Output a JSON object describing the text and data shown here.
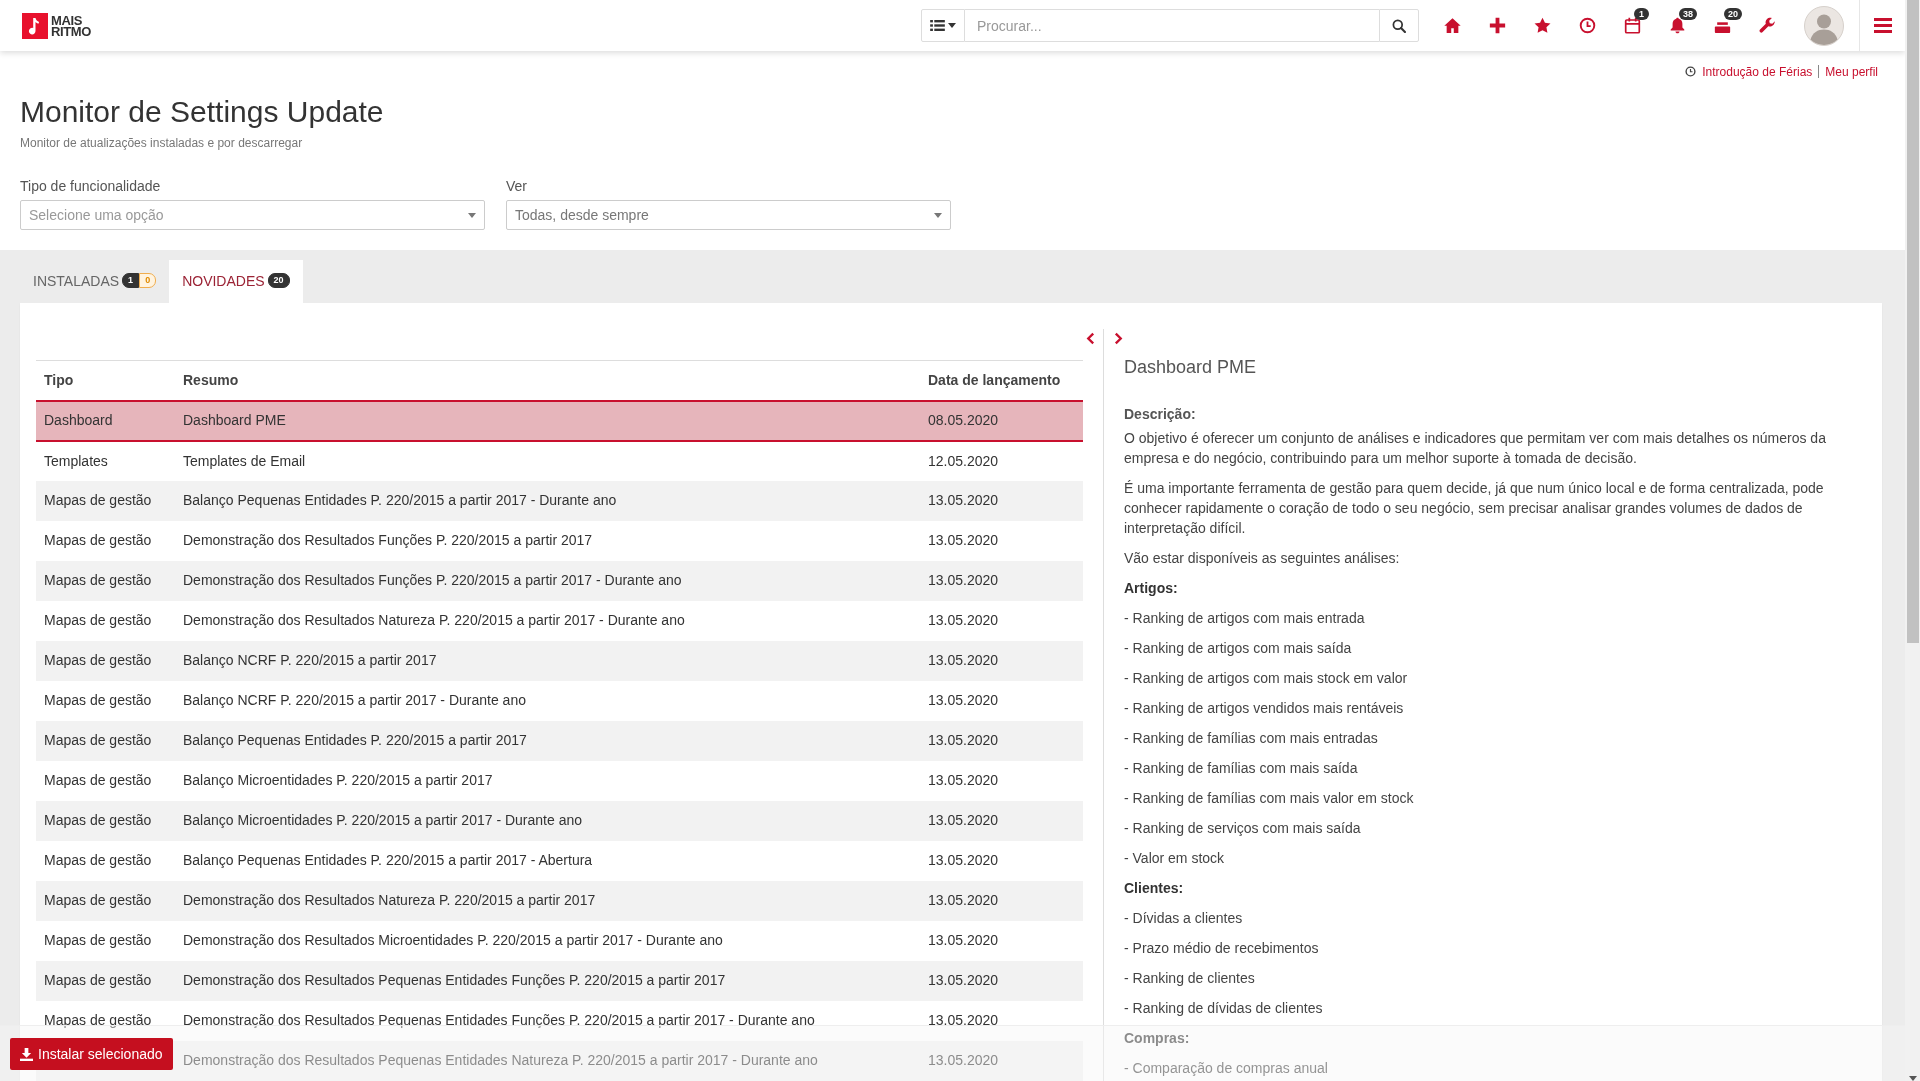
{
  "header": {
    "logo": {
      "line_1": "MAIS",
      "line_2": "RITMO"
    },
    "search": {
      "placeholder": "Procurar..."
    },
    "actions": [
      {
        "kind": "home"
      },
      {
        "kind": "plus"
      },
      {
        "kind": "star"
      },
      {
        "kind": "clock"
      },
      {
        "kind": "calendar",
        "count": "1"
      },
      {
        "kind": "bell",
        "count": "38"
      },
      {
        "kind": "tray",
        "count": "20"
      },
      {
        "kind": "wrench"
      }
    ]
  },
  "user_links": [
    "Introdução de Férias",
    "Meu perfil"
  ],
  "page": {
    "title": "Monitor de Settings Update",
    "subtitle": "Monitor de atualizações instaladas e por descarregar"
  },
  "filters": [
    {
      "label": "Tipo de funcionalidade",
      "placeholder": "Selecione uma opção"
    },
    {
      "label": "Ver",
      "value": "Todas, desde sempre"
    }
  ],
  "tabs": [
    {
      "label": "INSTALADAS",
      "selected": false,
      "badges": [
        {
          "text": "1",
          "kind": "dark"
        },
        {
          "text": "0",
          "kind": "warning"
        }
      ]
    },
    {
      "label": "NOVIDADES",
      "selected": true,
      "badges": [
        {
          "text": "20",
          "kind": "dark"
        }
      ]
    }
  ],
  "table": {
    "columns": [
      "Tipo",
      "Resumo",
      "Data de lançamento"
    ],
    "rows": [
      {
        "type": "Dashboard",
        "summary": "Dashboard PME",
        "date": "08.05.2020",
        "selected": true
      },
      {
        "type": "Templates",
        "summary": "Templates de Email",
        "date": "12.05.2020",
        "selected": false
      },
      {
        "type": "Mapas de gestão",
        "summary": "Balanço Pequenas Entidades P. 220/2015 a partir 2017 - Durante ano",
        "date": "13.05.2020",
        "selected": false
      },
      {
        "type": "Mapas de gestão",
        "summary": "Demonstração dos Resultados Funções P. 220/2015 a partir 2017",
        "date": "13.05.2020",
        "selected": false
      },
      {
        "type": "Mapas de gestão",
        "summary": "Demonstração dos Resultados Funções P. 220/2015 a partir 2017 - Durante ano",
        "date": "13.05.2020",
        "selected": false
      },
      {
        "type": "Mapas de gestão",
        "summary": "Demonstração dos Resultados Natureza P. 220/2015 a partir 2017 - Durante ano",
        "date": "13.05.2020",
        "selected": false
      },
      {
        "type": "Mapas de gestão",
        "summary": "Balanço NCRF P. 220/2015 a partir 2017",
        "date": "13.05.2020",
        "selected": false
      },
      {
        "type": "Mapas de gestão",
        "summary": "Balanço NCRF P. 220/2015 a partir 2017 - Durante ano",
        "date": "13.05.2020",
        "selected": false
      },
      {
        "type": "Mapas de gestão",
        "summary": "Balanço Pequenas Entidades P. 220/2015 a partir 2017",
        "date": "13.05.2020",
        "selected": false
      },
      {
        "type": "Mapas de gestão",
        "summary": "Balanço Microentidades P. 220/2015 a partir 2017",
        "date": "13.05.2020",
        "selected": false
      },
      {
        "type": "Mapas de gestão",
        "summary": "Balanço Microentidades P. 220/2015 a partir 2017 - Durante ano",
        "date": "13.05.2020",
        "selected": false
      },
      {
        "type": "Mapas de gestão",
        "summary": "Balanço Pequenas Entidades P. 220/2015 a partir 2017 - Abertura",
        "date": "13.05.2020",
        "selected": false
      },
      {
        "type": "Mapas de gestão",
        "summary": "Demonstração dos Resultados Natureza P. 220/2015 a partir 2017",
        "date": "13.05.2020",
        "selected": false
      },
      {
        "type": "Mapas de gestão",
        "summary": "Demonstração dos Resultados Microentidades P. 220/2015 a partir 2017 - Durante ano",
        "date": "13.05.2020",
        "selected": false
      },
      {
        "type": "Mapas de gestão",
        "summary": "Demonstração dos Resultados Pequenas Entidades Funções P. 220/2015 a partir 2017",
        "date": "13.05.2020",
        "selected": false
      },
      {
        "type": "Mapas de gestão",
        "summary": "Demonstração dos Resultados Pequenas Entidades Funções P. 220/2015 a partir 2017 - Durante ano",
        "date": "13.05.2020",
        "selected": false
      },
      {
        "summary": "Demonstração dos Resultados Pequenas Entidades Natureza P. 220/2015 a partir 2017 - Durante ano",
        "date": "13.05.2020",
        "selected": false
      }
    ]
  },
  "detail": {
    "title": "Dashboard PME",
    "blocks": [
      {
        "kind": "label",
        "text": "Descrição:"
      },
      {
        "kind": "paragraph",
        "text": "O objetivo é oferecer um conjunto de análises e indicadores que permitam ver com mais detalhes os números da empresa e do negócio, contribuindo para um melhor suporte à tomada de decisão."
      },
      {
        "kind": "paragraph",
        "text": "É uma importante ferramenta de gestão para quem decide, já que num único local e de forma centralizada, pode conhecer rapidamente o coração de todo o seu negócio, sem precisar analisar grandes volumes de dados de interpretação difícil."
      },
      {
        "kind": "paragraph",
        "text": "Vão estar disponíveis as seguintes análises:"
      },
      {
        "kind": "heading",
        "text": "Artigos:"
      },
      {
        "kind": "item",
        "text": "- Ranking de artigos com mais entrada"
      },
      {
        "kind": "item",
        "text": "- Ranking de artigos com mais saída"
      },
      {
        "kind": "item",
        "text": "- Ranking de artigos com mais stock em valor"
      },
      {
        "kind": "item",
        "text": "- Ranking de artigos vendidos mais rentáveis"
      },
      {
        "kind": "item",
        "text": "- Ranking de famílias com mais entradas"
      },
      {
        "kind": "item",
        "text": "- Ranking de famílias com mais saída"
      },
      {
        "kind": "item",
        "text": "- Ranking de famílias com mais valor em stock"
      },
      {
        "kind": "item",
        "text": "- Ranking de serviços com mais saída"
      },
      {
        "kind": "item",
        "text": "- Valor em stock"
      },
      {
        "kind": "heading",
        "text": "Clientes:"
      },
      {
        "kind": "item",
        "text": "- Dívidas a clientes"
      },
      {
        "kind": "item",
        "text": "- Prazo médio de recebimentos"
      },
      {
        "kind": "item",
        "text": "- Ranking de clientes"
      },
      {
        "kind": "item",
        "text": "- Ranking de dívidas de clientes"
      },
      {
        "kind": "heading",
        "text": "Compras:"
      },
      {
        "kind": "item",
        "text": "- Comparação de compras anual"
      }
    ]
  },
  "footer": {
    "install_button": "Instalar selecionado"
  }
}
